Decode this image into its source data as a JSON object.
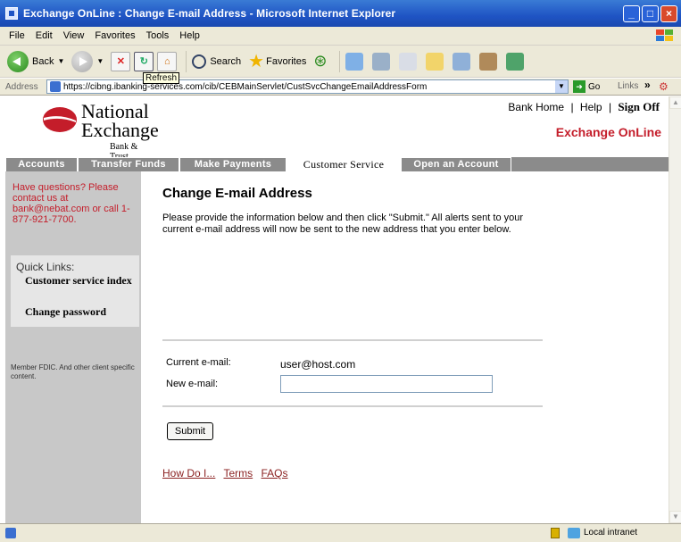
{
  "window": {
    "title": "Exchange OnLine : Change E-mail Address - Microsoft Internet Explorer",
    "controls": [
      "_",
      "□",
      "×"
    ]
  },
  "menu": [
    "File",
    "Edit",
    "View",
    "Favorites",
    "Tools",
    "Help"
  ],
  "toolbar": {
    "back_label": "Back",
    "search_label": "Search",
    "favorites_label": "Favorites",
    "refresh_tooltip": "Refresh"
  },
  "address": {
    "label": "Address",
    "url": "https://cibng.ibanking-services.com/cib/CEBMainServlet/CustSvcChangeEmailAddressForm",
    "go_label": "Go",
    "links_label": "Links"
  },
  "site": {
    "logo": {
      "line1": "National",
      "line2": "Exchange",
      "line3": "Bank & Trust"
    },
    "top_links": {
      "home": "Bank Home",
      "sep": "|",
      "help": "Help",
      "signoff": "Sign Off"
    },
    "brand_tagline": "Exchange OnLine",
    "nav": [
      {
        "label": "Accounts"
      },
      {
        "label": "Transfer Funds"
      },
      {
        "label": "Make Payments"
      },
      {
        "label": "Customer Service"
      },
      {
        "label": "Open an Account"
      }
    ]
  },
  "sidebar": {
    "help_text": "Have questions? Please contact us at bank@nebat.com or call 1-877-921-7700.",
    "quick_links_title": "Quick Links:",
    "quick_links": [
      "Customer service index",
      "Change password"
    ],
    "member_text": "Member FDIC. And other client specific content."
  },
  "main": {
    "title": "Change E-mail Address",
    "intro": "Please provide the information below and then click \"Submit.\" All alerts sent to your current e-mail address will now be sent to the new address that you enter below.",
    "current_label": "Current e-mail:",
    "current_value": "user@host.com",
    "new_label": "New e-mail:",
    "new_value": "",
    "submit_label": "Submit",
    "footer_links": [
      "How Do I...",
      "Terms",
      "FAQs"
    ]
  },
  "status": {
    "zone": "Local intranet"
  },
  "colors": {
    "brand_red": "#c41d2a",
    "nav_gray": "#8b8b8b",
    "sidebar_gray": "#c8c8c8",
    "title_blue": "#1f54c4"
  }
}
